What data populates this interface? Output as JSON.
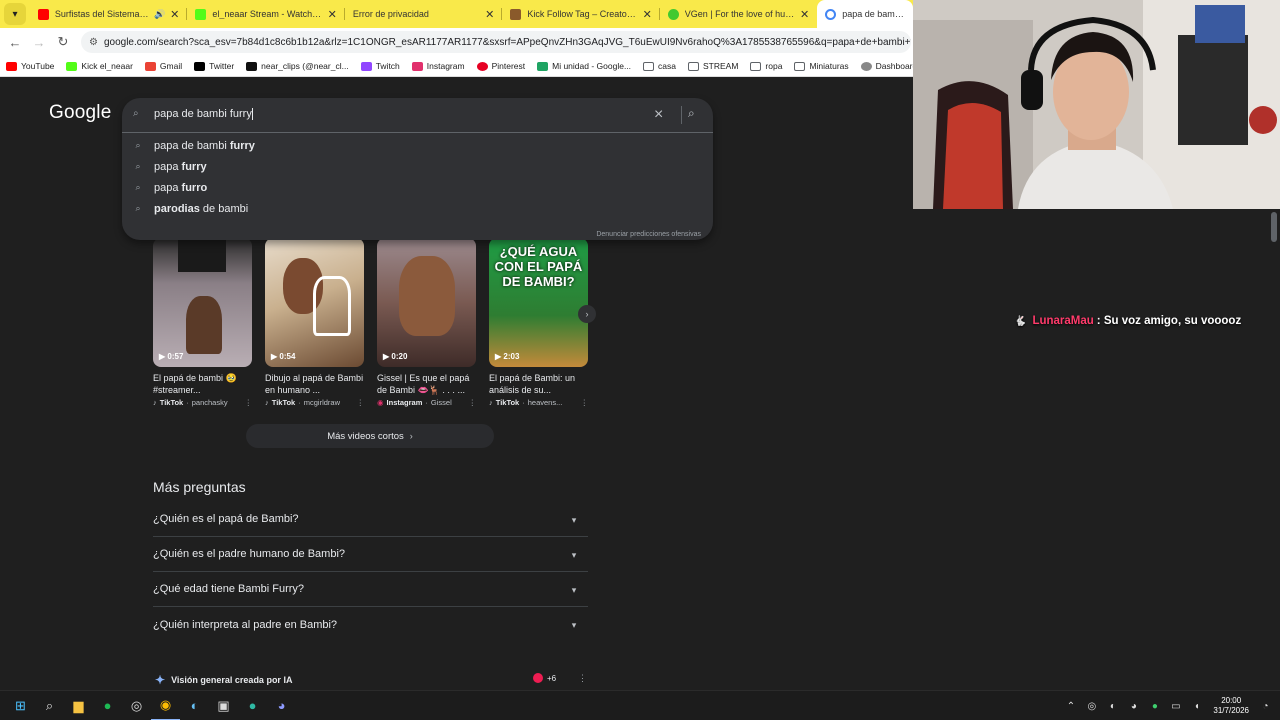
{
  "tabs": [
    {
      "title": "Surfistas del Sistema - Sesió",
      "favicon_color": "#ff0000",
      "extra": "🔊",
      "icon": "youtube-icon"
    },
    {
      "title": "el_neaar Stream - Watch Live o",
      "favicon_color": "#53fc18",
      "icon": "kick-icon"
    },
    {
      "title": "Error de privacidad",
      "favicon_color": "#f9e94a",
      "icon": "warning-icon"
    },
    {
      "title": "Kick Follow Tag – CreatorSet",
      "favicon_color": "#8a5a2b",
      "icon": "creatorset-icon"
    },
    {
      "title": "VGen | For the love of human c",
      "favicon_color": "#42c92f",
      "icon": "vgen-icon"
    },
    {
      "title": "papa de bambi furry",
      "favicon_color": "#4285f4",
      "icon": "google-icon",
      "active": true
    }
  ],
  "toolbar": {
    "url": "google.com/search?sca_esv=7b84d1c8c6b1b12a&rlz=1C1ONGR_esAR1177AR1177&sxsrf=APpeQnvZHn3GAqJVG_T6uEwUI9Nv6rahoQ%3A1785538765596&q=papa+de+bambi+furry&source=lnms"
  },
  "bookmarks": [
    {
      "label": "YouTube",
      "color": "#ff0000"
    },
    {
      "label": "Kick el_neaar",
      "color": "#53fc18"
    },
    {
      "label": "Gmail",
      "color": "#ea4335"
    },
    {
      "label": "Twitter",
      "color": "#000000"
    },
    {
      "label": "near_clips (@near_cl...",
      "color": "#111111"
    },
    {
      "label": "Twitch",
      "color": "#9146ff"
    },
    {
      "label": "Instagram",
      "color": "#e1306c"
    },
    {
      "label": "Pinterest",
      "color": "#e60023"
    },
    {
      "label": "Mi unidad - Google...",
      "color": "#1fa463"
    },
    {
      "label": "casa",
      "color": "#5f6368"
    },
    {
      "label": "STREAM",
      "color": "#5f6368"
    },
    {
      "label": "ropa",
      "color": "#5f6368"
    },
    {
      "label": "Miniaturas",
      "color": "#5f6368"
    },
    {
      "label": "Dashboard — Solve...",
      "color": "#888888"
    }
  ],
  "logo": "Google",
  "search": {
    "query": "papa de bambi furry",
    "suggestions": [
      {
        "plain": "papa de bambi ",
        "bold": "furry",
        "bold_first": false
      },
      {
        "plain": "papa ",
        "bold": "furry",
        "bold_first": false
      },
      {
        "plain": "papa ",
        "bold": "furro",
        "bold_first": false
      },
      {
        "plain": " de bambi",
        "bold": "parodias",
        "bold_first": true
      }
    ],
    "report": "Denunciar predicciones ofensivas"
  },
  "videos": [
    {
      "duration": "▶ 0:57",
      "title": "El papá de bambi 🥹 #streamer...",
      "platform": "TikTok",
      "author": "panchasky",
      "colors": [
        "#8a7f86",
        "#3b2f2a"
      ]
    },
    {
      "duration": "▶ 0:54",
      "title": "Dibujo al papá de Bambi en humano ...",
      "platform": "TikTok",
      "author": "mcgirldraw",
      "colors": [
        "#d6c3a8",
        "#6b4a32"
      ]
    },
    {
      "duration": "▶ 0:20",
      "title": "Gissel | Es que el papá de Bambi 👄🦌 . . . ...",
      "platform": "Instagram",
      "author": "Gissel",
      "colors": [
        "#7a5a52",
        "#3e2b28"
      ]
    },
    {
      "duration": "▶ 2:03",
      "title": "El papá de Bambi: un análisis de su...",
      "platform": "TikTok",
      "author": "heavens...",
      "colors": [
        "#1f9d45",
        "#c48a3a"
      ],
      "overlay": "¿QUÉ AGUA CON EL PAPÁ DE BAMBI?"
    }
  ],
  "more_shorts": "Más videos cortos",
  "paa": {
    "title": "Más preguntas",
    "questions": [
      "¿Quién es el papá de Bambi?",
      "¿Quién es el padre humano de Bambi?",
      "¿Qué edad tiene Bambi Furry?",
      "¿Quién interpreta al padre en Bambi?"
    ]
  },
  "ai_overview": {
    "label": "Visión general creada por IA",
    "sources": "+6"
  },
  "chat": {
    "user": "LunaraMau",
    "message": ": Su voz amigo, su vooooz"
  },
  "clock": {
    "time": "20:00",
    "date": "31/7/2026"
  }
}
